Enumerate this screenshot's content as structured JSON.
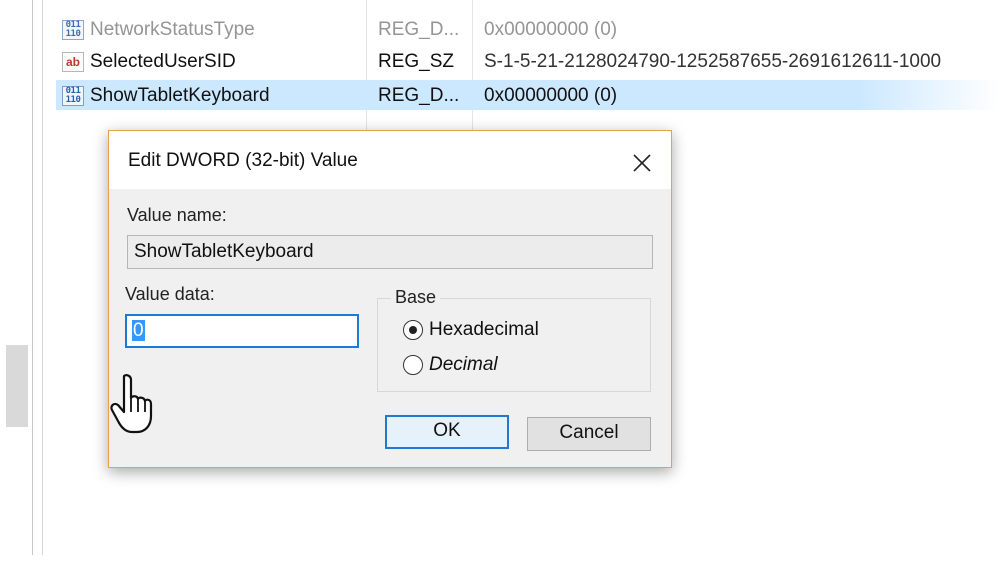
{
  "registry": {
    "rows": [
      {
        "name": "NetworkStatusType",
        "type": "REG_D...",
        "data": "0x00000000 (0)",
        "icon": "binary-value-icon"
      },
      {
        "name": "SelectedUserSID",
        "type": "REG_SZ",
        "data": "S-1-5-21-2128024790-1252587655-2691612611-1000",
        "icon": "string-value-icon"
      },
      {
        "name": "ShowTabletKeyboard",
        "type": "REG_D...",
        "data": "0x00000000 (0)",
        "icon": "binary-value-icon"
      }
    ],
    "icon_text": {
      "binary": "011\n110",
      "string": "ab"
    }
  },
  "dialog": {
    "title": "Edit DWORD (32-bit) Value",
    "value_name_label": "Value name:",
    "value_name": "ShowTabletKeyboard",
    "value_data_label": "Value data:",
    "value_data": "0",
    "base_label": "Base",
    "base_options": [
      "Hexadecimal",
      "Decimal"
    ],
    "base_selected": "Hexadecimal",
    "ok_label": "OK",
    "cancel_label": "Cancel"
  },
  "colors": {
    "selection": "#cce8ff",
    "focus_border": "#1f78d1",
    "dialog_border": "#e8a04c"
  }
}
